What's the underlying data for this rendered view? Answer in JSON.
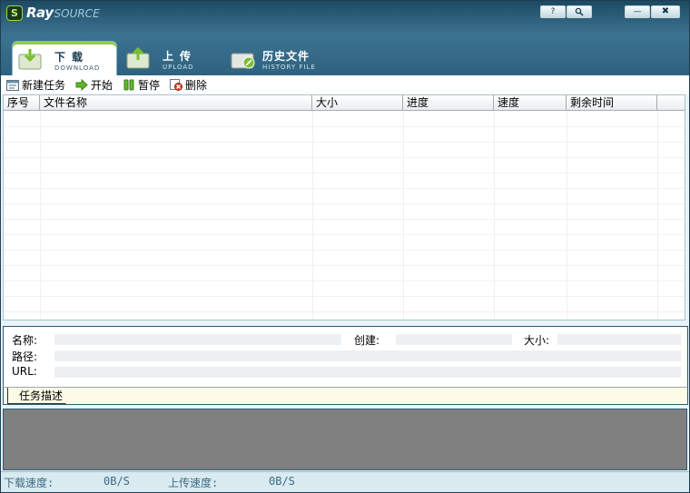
{
  "app": {
    "logo_ray": "Ray",
    "logo_source": "SOURCE",
    "help_label": "?",
    "search_label": "🔍",
    "minimize_label": "—",
    "close_label": "✖"
  },
  "tabs": [
    {
      "title": "下载",
      "subtitle": "DOWNLOAD",
      "active": true
    },
    {
      "title": "上传",
      "subtitle": "UPLOAD",
      "active": false
    },
    {
      "title": "历史文件",
      "subtitle": "HISTORY FILE",
      "active": false
    }
  ],
  "toolbar": {
    "new_task": "新建任务",
    "start": "开始",
    "pause": "暂停",
    "delete": "删除"
  },
  "table": {
    "columns": [
      "序号",
      "文件名称",
      "大小",
      "进度",
      "速度",
      "剩余时间"
    ],
    "rows": []
  },
  "info": {
    "name_label": "名称:",
    "created_label": "创建:",
    "size_label": "大小:",
    "path_label": "路径:",
    "url_label": "URL:",
    "name_value": "",
    "created_value": "",
    "size_value": "",
    "path_value": "",
    "url_value": ""
  },
  "description": {
    "tab_label": "任务描述"
  },
  "status": {
    "download_label": "下载速度:",
    "download_value": "0B/S",
    "upload_label": "上传速度:",
    "upload_value": "0B/S"
  },
  "colors": {
    "header": "#2d6280",
    "accent_green": "#8fcf3c",
    "status_text": "#3c6b84"
  }
}
